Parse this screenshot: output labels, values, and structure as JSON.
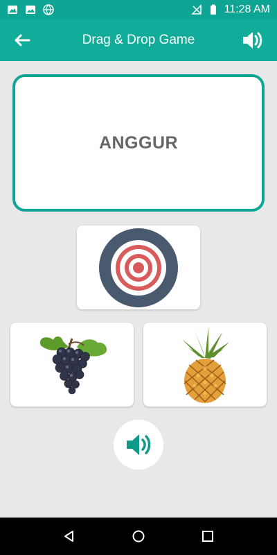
{
  "status_bar": {
    "time": "11:28 AM",
    "icons": [
      "notification-image-icon",
      "notification-gallery-icon",
      "notification-globe-icon",
      "signal-off-icon",
      "battery-icon"
    ]
  },
  "app_bar": {
    "title": "Drag & Drop Game",
    "back_icon": "back-arrow-icon",
    "sound_icon": "speaker-icon"
  },
  "game": {
    "word": "ANGGUR",
    "drop_target_icon": "target-icon",
    "options": [
      {
        "name": "grapes",
        "icon": "grapes-image"
      },
      {
        "name": "pineapple",
        "icon": "pineapple-image"
      }
    ],
    "play_sound_icon": "speaker-icon"
  },
  "nav_bar": {
    "items": [
      "back-nav",
      "home-nav",
      "recents-nav"
    ]
  },
  "colors": {
    "primary": "#11ad9a",
    "primary_dark": "#0fa595",
    "target_ring": "#4a5a6e",
    "target_red": "#d95c5c"
  }
}
